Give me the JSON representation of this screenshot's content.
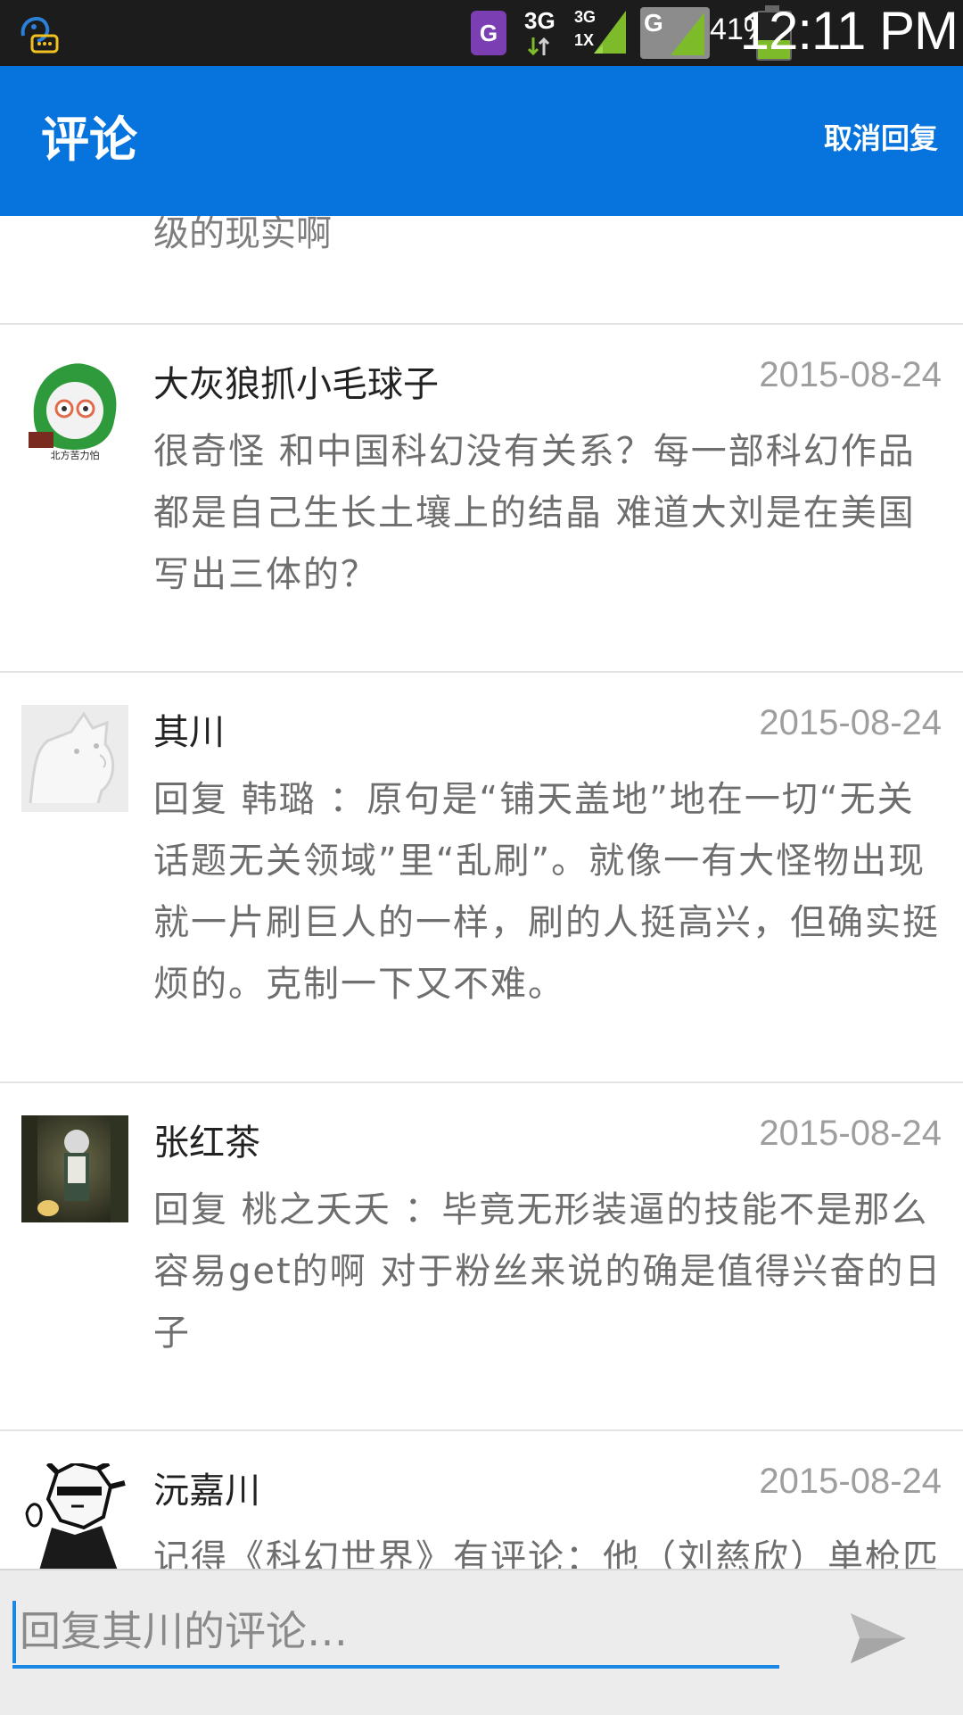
{
  "status_bar": {
    "net_badge": "G",
    "net_type": "3G",
    "net_type_small_top": "3G",
    "net_type_small_bottom": "1X",
    "signal_box_label": "G",
    "battery_percent": "41%",
    "battery_level": 0.41,
    "time": "12:11 PM",
    "colors": {
      "badge": "#7b3fb3",
      "signal": "#7dbb2b"
    }
  },
  "header": {
    "title": "评论",
    "action": "取消回复",
    "color": "#0774dd"
  },
  "partial_previous": {
    "text": "级的现实啊"
  },
  "comments": [
    {
      "name": "大灰狼抓小毛球子",
      "date": "2015-08-24",
      "content": "很奇怪 和中国科幻没有关系？每一部科幻作品都是自己生长土壤上的结晶 难道大刘是在美国写出三体的？",
      "avatar_label": "北方苦力怕"
    },
    {
      "name": "其川",
      "date": "2015-08-24",
      "content": "回复 韩璐 ：原句是“铺天盖地”地在一切“无关话题无关领域”里“乱刷”。就像一有大怪物出现就一片刷巨人的一样，刷的人挺高兴，但确实挺烦的。克制一下又不难。"
    },
    {
      "name": "张红茶",
      "date": "2015-08-24",
      "content": "回复 桃之夭夭 ：毕竟无形装逼的技能不是那么容易get的啊 对于粉丝来说的确是值得兴奋的日子"
    },
    {
      "name": "沅嘉川",
      "date": "2015-08-24",
      "content": "记得《科幻世界》有评论：他（刘慈欣）单枪匹"
    }
  ],
  "input": {
    "placeholder": "回复其川的评论…",
    "value": ""
  }
}
